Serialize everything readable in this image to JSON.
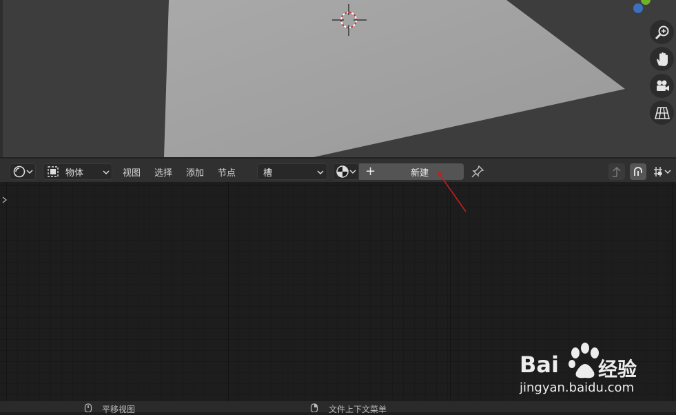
{
  "header": {
    "object_mode": "物体",
    "menus": [
      "视图",
      "选择",
      "添加",
      "节点"
    ],
    "slot": "槽",
    "new_label": "新建",
    "new_plus": "+"
  },
  "viewport": {
    "tools": [
      "zoom-icon",
      "hand-icon",
      "camera-icon",
      "grid-icon"
    ]
  },
  "status": {
    "left_label": "平移视图",
    "right_label": "文件上下文菜单"
  },
  "watermark": {
    "brand": "Bai",
    "brand_cn": "经验",
    "url": "jingyan.baidu.com"
  },
  "colors": {
    "annotation_arrow": "#c41e1e",
    "new_button": "#545454",
    "plane": "#a8a8a8"
  }
}
